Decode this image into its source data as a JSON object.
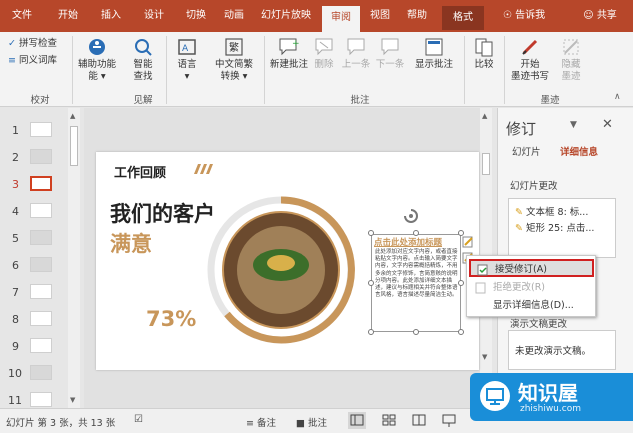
{
  "tabs": [
    "文件",
    "开始",
    "插入",
    "设计",
    "切换",
    "动画",
    "幻灯片放映",
    "审阅",
    "视图",
    "帮助",
    "格式"
  ],
  "tell_me": "告诉我",
  "share": "共享",
  "ribbon": {
    "spell_check": "拼写检查",
    "thesaurus": "同义词库",
    "group_proofing": "校对",
    "accessibility": "辅助功能",
    "accessibility_arrow": "能 ▾",
    "smart_lookup_1": "智能",
    "smart_lookup_2": "查找",
    "group_insights": "见解",
    "language": "语言",
    "language_arrow": "▾",
    "convert_1": "中文简繁",
    "convert_2": "转换 ▾",
    "new_comment": "新建批注",
    "delete": "删除",
    "prev": "上一条",
    "next": "下一条",
    "show_comments": "显示批注",
    "group_comments": "批注",
    "compare": "比较",
    "start_inking_1": "开始",
    "start_inking_2": "墨迹书写",
    "hide_ink_1": "隐藏",
    "hide_ink_2": "墨迹",
    "group_ink": "墨迹"
  },
  "thumbnails": [
    "1",
    "2",
    "3",
    "4",
    "5",
    "6",
    "7",
    "8",
    "9",
    "10",
    "11"
  ],
  "selected_slide": "3",
  "slide": {
    "heading": "工作回顾",
    "title_line1": "我们的客户",
    "title_line2": "满意",
    "percent": "73%",
    "textbox_title": "点击此处添加标题",
    "textbox_body": "此处添加对应文字内容，或者直接粘贴文字内容。点击输入简要文字内容，文字内容需概括精炼，不用多余的文字修饰，言简意赅的说明分项内容。此处添加详细文本描述，建议与标题相关并符合整体语言风格，语言描述尽量简洁生动。"
  },
  "revisions_pane": {
    "title": "修订",
    "tab_slides": "幻灯片",
    "tab_details": "详细信息",
    "section_slide_changes": "幻灯片更改",
    "item1": "文本框 8: 标...",
    "item2": "矩形 25: 点击...",
    "section_presentation": "演示文稿更改",
    "not_changed": "未更改演示文稿。"
  },
  "context_menu": {
    "accept": "接受修订(A)",
    "reject": "拒绝更改(R)",
    "details": "显示详细信息(D)..."
  },
  "statusbar": {
    "slide_info": "幻灯片 第 3 张，共 13 张",
    "notes": "备注",
    "comments": "批注"
  },
  "watermark": {
    "name": "知识屋",
    "url": "zhishiwu.com"
  },
  "colors": {
    "brand": "#b7472a",
    "accent_gold": "#c8965a",
    "highlight_red": "#d02020"
  }
}
